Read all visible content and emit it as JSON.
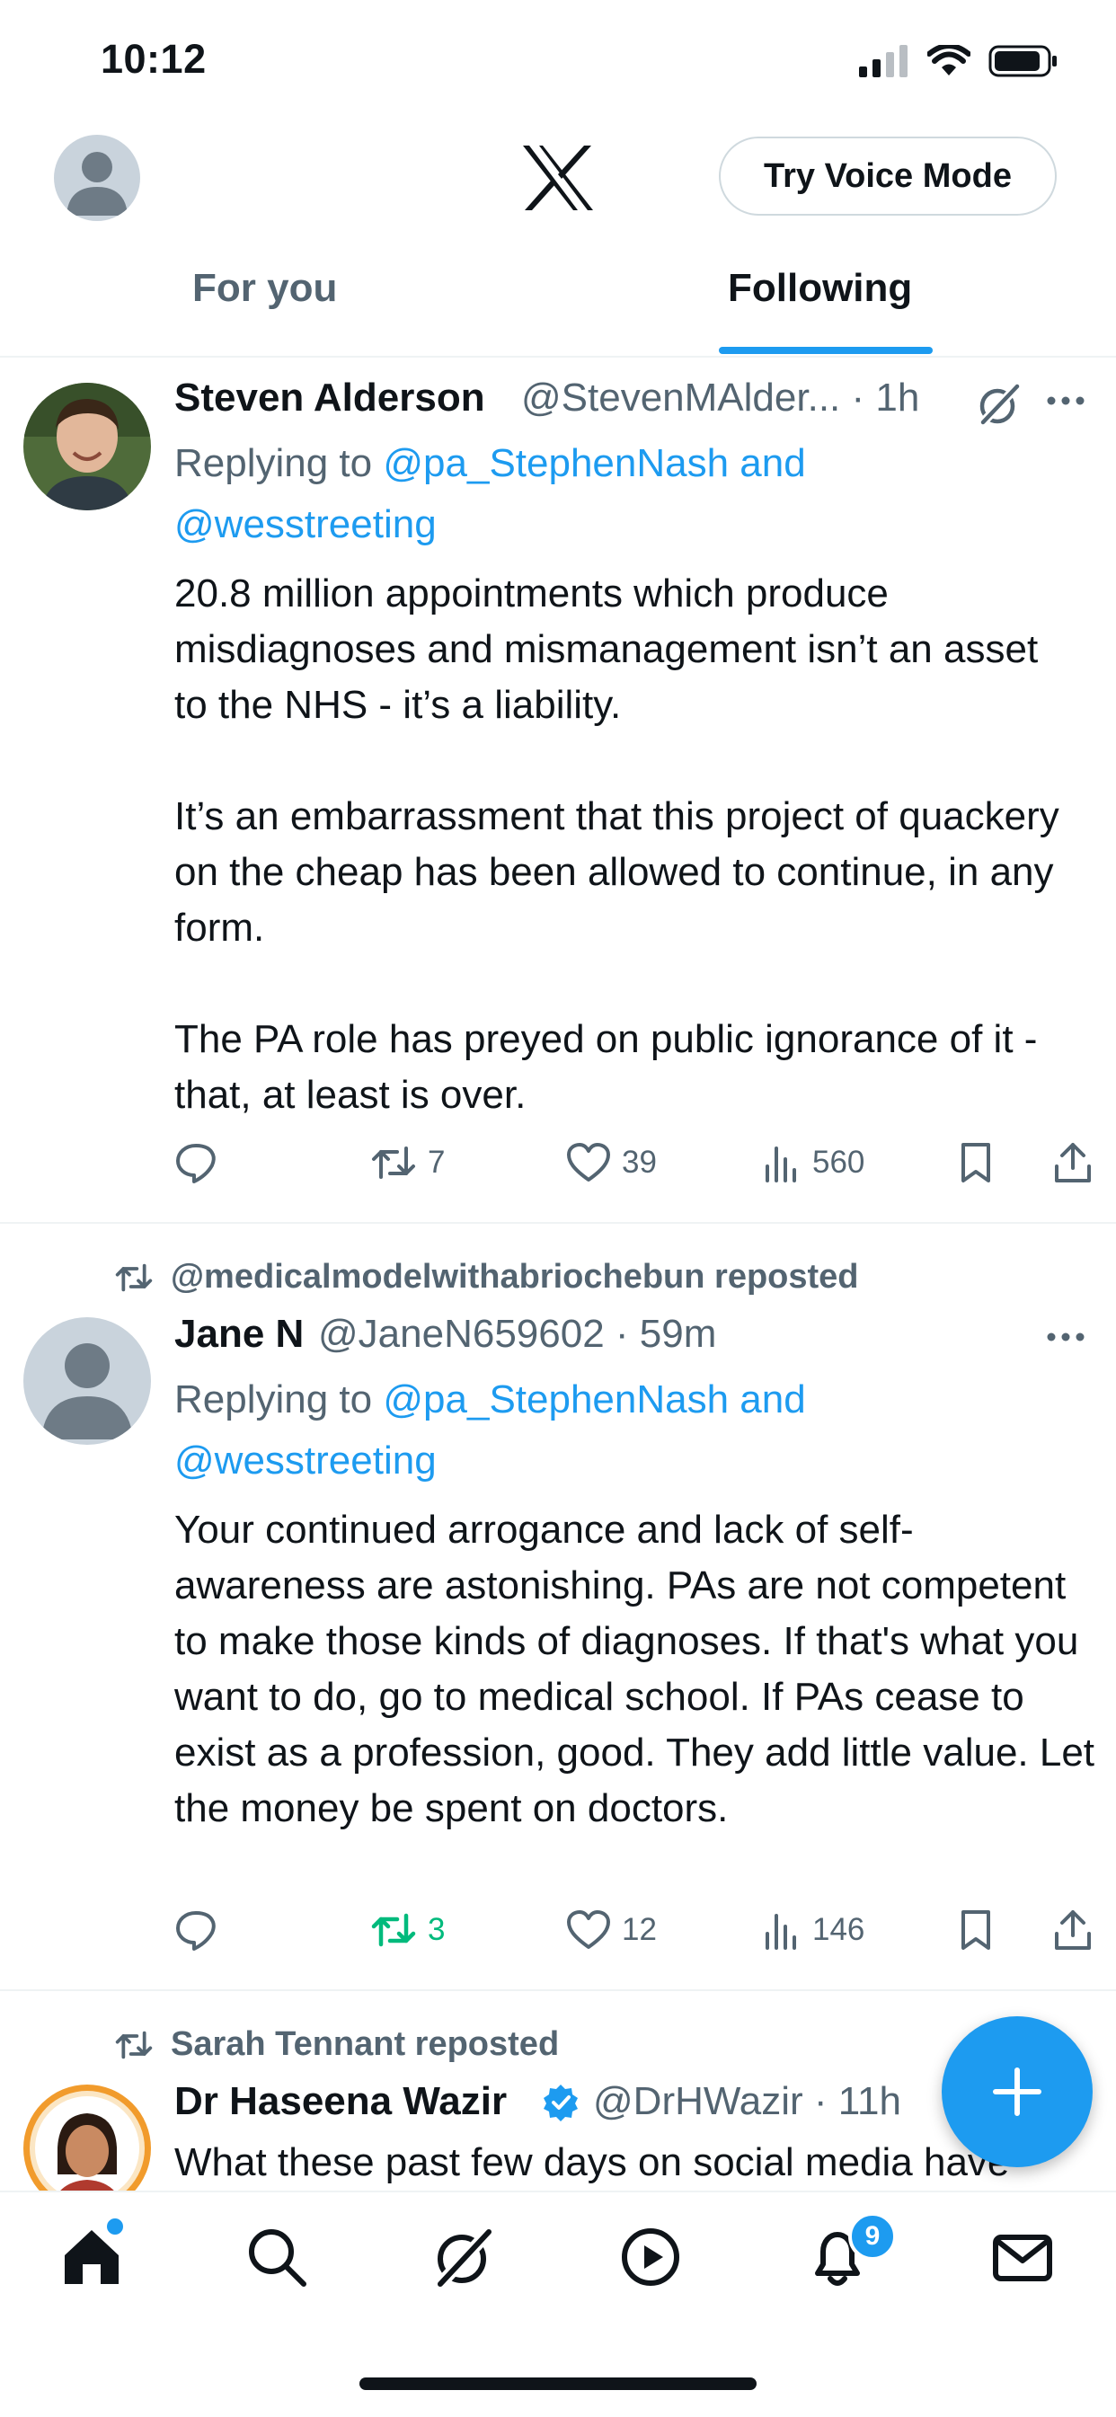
{
  "status_bar": {
    "time": "10:12"
  },
  "header": {
    "voice_button": "Try Voice Mode"
  },
  "tabs": [
    {
      "label": "For you",
      "active": false
    },
    {
      "label": "Following",
      "active": true
    }
  ],
  "posts": [
    {
      "author_name": "Steven Alderson",
      "handle": "@StevenMAlder...",
      "time": "· 1h",
      "replying_prefix": "Replying to ",
      "replying_to": "@pa_StephenNash and @wesstreeting",
      "text_paragraphs": [
        "20.8 million appointments which produce misdiagnoses and mismanagement isn’t an asset to the NHS - it’s a liability.",
        "It’s an embarrassment that this project of quackery on the cheap has been allowed to continue, in any form.",
        "The PA role has preyed on public ignorance of it - that, at least is over."
      ],
      "reposts": "7",
      "likes": "39",
      "views": "560"
    },
    {
      "reposted_by": "@medicalmodelwithabriochebun reposted",
      "author_name": "Jane N",
      "handle": "@JaneN659602",
      "time": "· 59m",
      "replying_prefix": "Replying to ",
      "replying_to": "@pa_StephenNash and @wesstreeting",
      "text_paragraphs": [
        "Your continued arrogance and lack of self-awareness are astonishing. PAs are not competent to make those kinds of diagnoses. If that's what you want to do, go to medical school. If PAs cease to exist as a profession, good. They add little value. Let the money be spent on doctors."
      ],
      "reposts": "3",
      "likes": "12",
      "views": "146"
    },
    {
      "reposted_by": "Sarah Tennant reposted",
      "author_name": "Dr Haseena Wazir",
      "handle": "@DrHWazir",
      "time": "· 11h",
      "text_preview": "What these past few days on social media have"
    }
  ],
  "bottom_nav": {
    "notifications_badge": "9"
  },
  "colors": {
    "accent": "#1d9bf0",
    "repost_green": "#00ba7c",
    "secondary_text": "#536471",
    "primary_text": "#0f1419"
  }
}
